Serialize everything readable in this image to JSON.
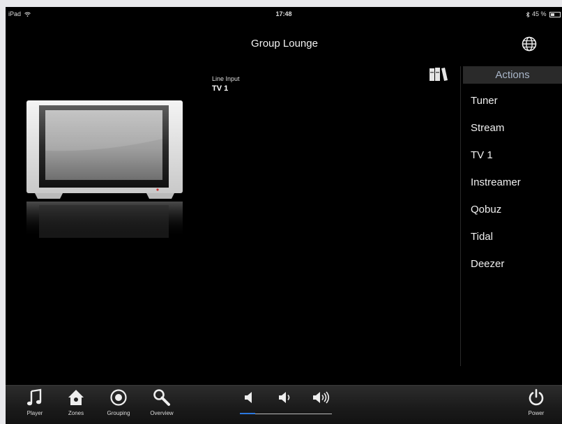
{
  "status_bar": {
    "device": "iPad",
    "time": "17:48",
    "battery": "45 %"
  },
  "header": {
    "title": "Group Lounge"
  },
  "source": {
    "label": "Line Input",
    "value": "TV 1"
  },
  "actions": {
    "header": "Actions",
    "items": [
      "Tuner",
      "Stream",
      "TV 1",
      "Instreamer",
      "Qobuz",
      "Tidal",
      "Deezer"
    ]
  },
  "toolbar": {
    "player": "Player",
    "zones": "Zones",
    "grouping": "Grouping",
    "overview": "Overview",
    "power": "Power",
    "volume_level": 0.17
  },
  "colors": {
    "accent": "#2c78e0",
    "actions_header_text": "#a9b6c9"
  },
  "icons": [
    "wifi-icon",
    "bluetooth-icon",
    "battery-icon",
    "globe-icon",
    "library-icon",
    "tv-image",
    "music-note-icon",
    "home-icon",
    "grouping-icon",
    "search-icon",
    "volume-low-icon",
    "volume-mid-icon",
    "volume-high-icon",
    "power-icon"
  ]
}
